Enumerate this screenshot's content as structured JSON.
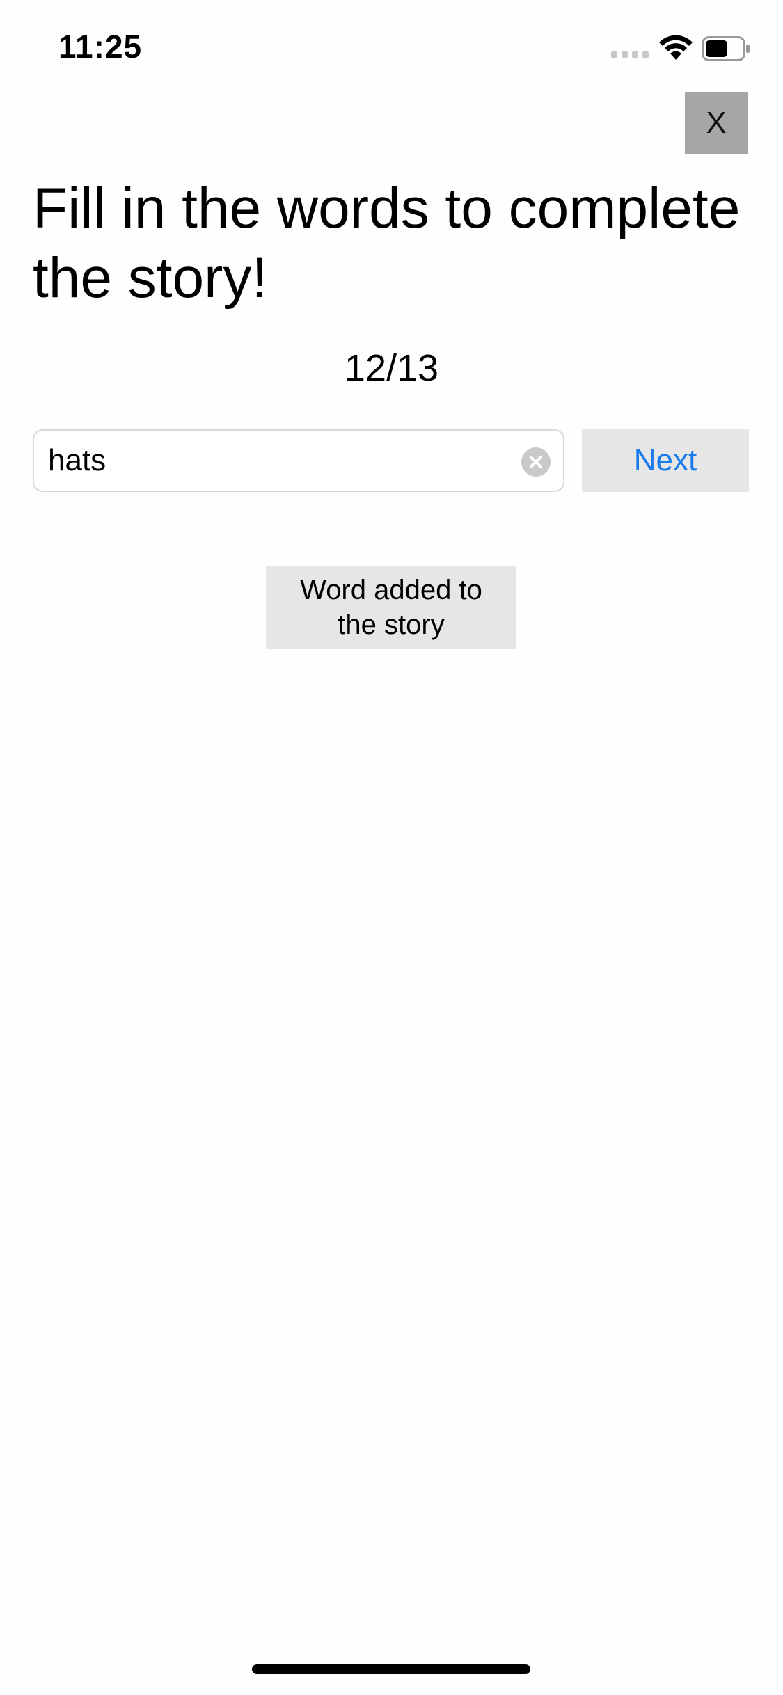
{
  "status_bar": {
    "time": "11:25",
    "icons": [
      "signal-icon",
      "wifi-icon",
      "battery-icon"
    ]
  },
  "close_button": {
    "label": "X"
  },
  "title": "Fill in the words to complete the story!",
  "progress": {
    "text": "12/13",
    "current": 12,
    "total": 13
  },
  "word_input": {
    "value": "hats",
    "placeholder": ""
  },
  "next_button": {
    "label": "Next"
  },
  "toast": {
    "message": "Word added to the story"
  },
  "colors": {
    "accent": "#1a7bea",
    "button_bg": "#e6e6e6",
    "close_bg": "#a6a6a6",
    "background": "#fefefe"
  }
}
